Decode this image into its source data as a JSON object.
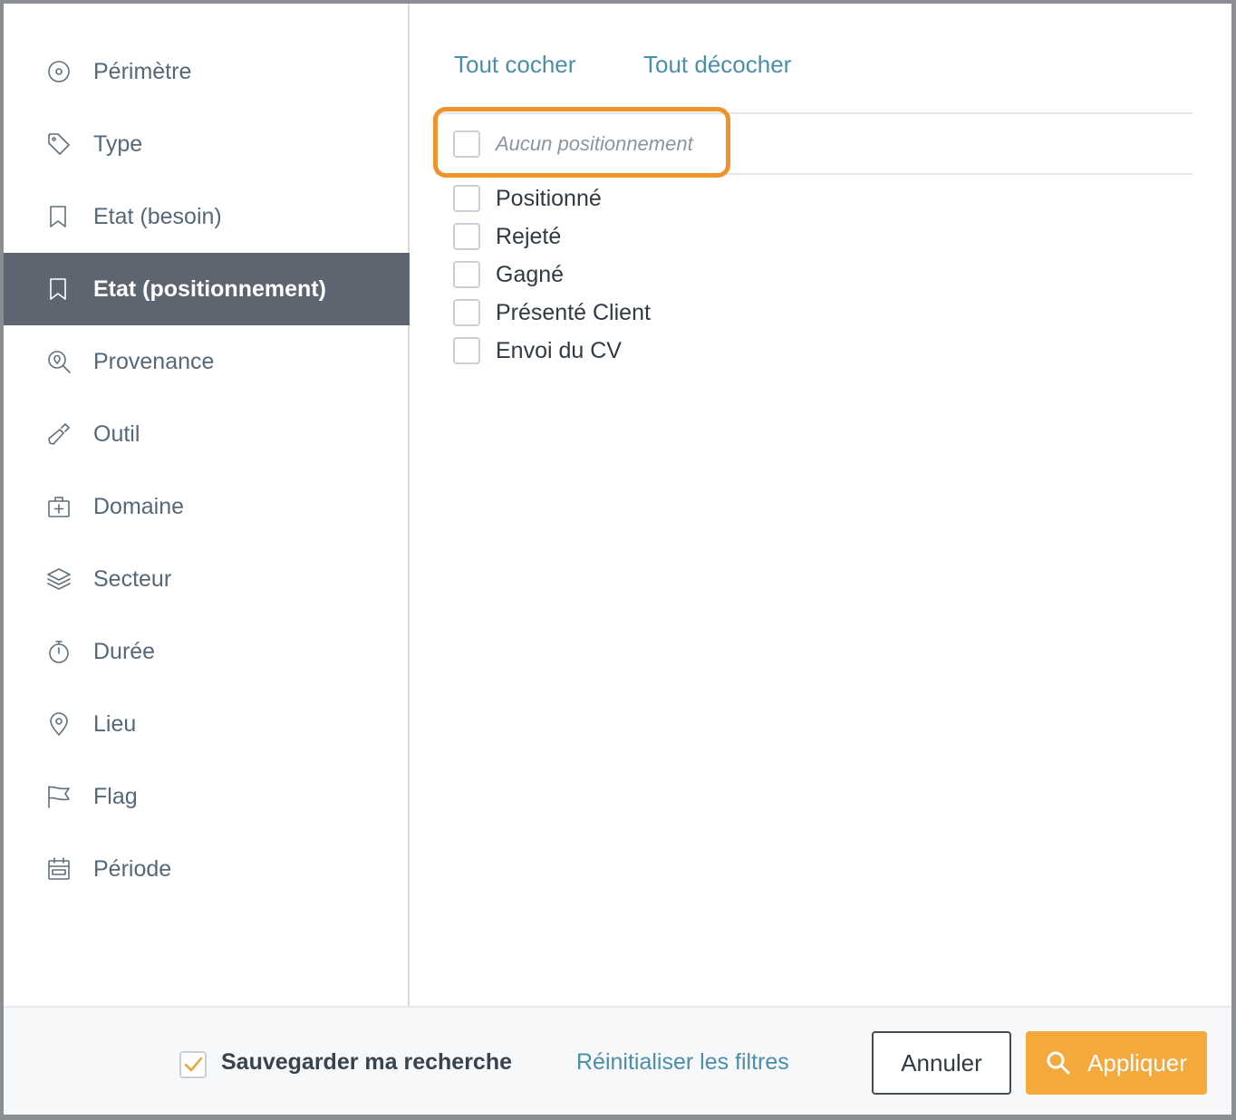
{
  "sidebar": {
    "items": [
      {
        "label": "Périmètre",
        "icon": "target-icon",
        "active": false
      },
      {
        "label": "Type",
        "icon": "tag-icon",
        "active": false
      },
      {
        "label": "Etat (besoin)",
        "icon": "bookmark-icon",
        "active": false
      },
      {
        "label": "Etat (positionnement)",
        "icon": "bookmark-icon",
        "active": true
      },
      {
        "label": "Provenance",
        "icon": "location-search-icon",
        "active": false
      },
      {
        "label": "Outil",
        "icon": "tool-icon",
        "active": false
      },
      {
        "label": "Domaine",
        "icon": "medical-case-icon",
        "active": false
      },
      {
        "label": "Secteur",
        "icon": "layers-icon",
        "active": false
      },
      {
        "label": "Durée",
        "icon": "stopwatch-icon",
        "active": false
      },
      {
        "label": "Lieu",
        "icon": "map-pin-icon",
        "active": false
      },
      {
        "label": "Flag",
        "icon": "flag-icon",
        "active": false
      },
      {
        "label": "Période",
        "icon": "calendar-icon",
        "active": false
      }
    ]
  },
  "content": {
    "check_all": "Tout cocher",
    "uncheck_all": "Tout décocher",
    "none_option": "Aucun positionnement",
    "options": [
      {
        "label": "Positionné",
        "checked": false
      },
      {
        "label": "Rejeté",
        "checked": false
      },
      {
        "label": "Gagné",
        "checked": false
      },
      {
        "label": "Présenté Client",
        "checked": false
      },
      {
        "label": "Envoi du CV",
        "checked": false
      }
    ]
  },
  "footer": {
    "save_search_label": "Sauvegarder ma recherche",
    "save_search_checked": true,
    "reset_label": "Réinitialiser les filtres",
    "cancel_label": "Annuler",
    "apply_label": "Appliquer"
  },
  "colors": {
    "accent": "#f4a93d",
    "link": "#4a8eaa",
    "active_bg": "#5d6670",
    "highlight": "#f0932b"
  }
}
